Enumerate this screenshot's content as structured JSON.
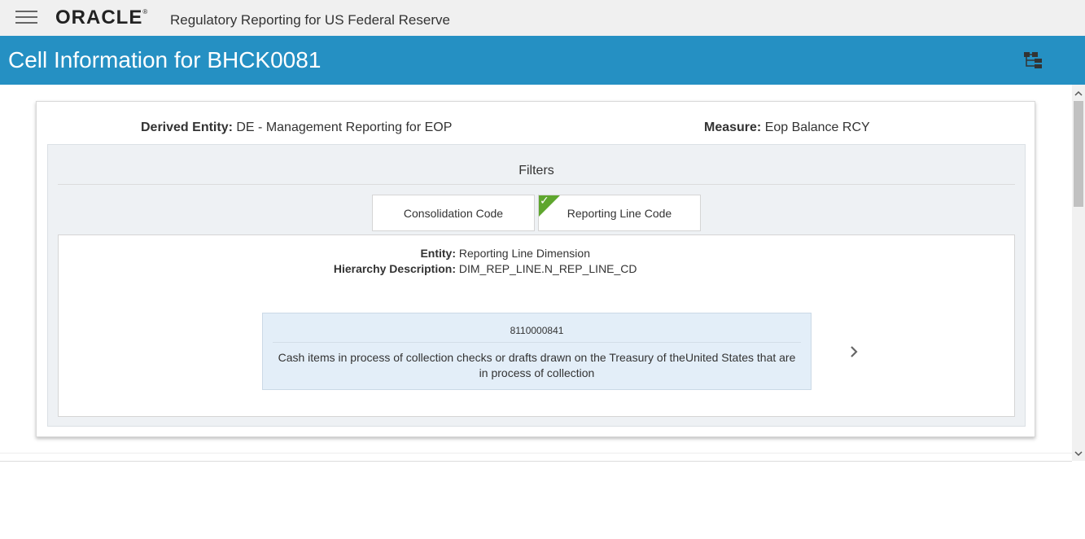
{
  "header": {
    "brand": "ORACLE",
    "app_title": "Regulatory Reporting for US Federal Reserve"
  },
  "title_bar": {
    "title": "Cell Information for BHCK0081"
  },
  "cell_info": {
    "derived_entity_label": "Derived Entity:",
    "derived_entity_value": "DE - Management Reporting for EOP",
    "measure_label": "Measure:",
    "measure_value": "Eop Balance RCY"
  },
  "filters": {
    "title": "Filters",
    "tabs": [
      {
        "label": "Consolidation Code",
        "checked": false
      },
      {
        "label": "Reporting Line Code",
        "checked": true
      }
    ]
  },
  "detail": {
    "entity_label": "Entity:",
    "entity_value": "Reporting Line Dimension",
    "hierarchy_label": "Hierarchy Description:",
    "hierarchy_value": "DIM_REP_LINE.N_REP_LINE_CD"
  },
  "node": {
    "code": "8110000841",
    "description": "Cash items in process of collection checks or drafts drawn on the Treasury of theUnited States that are in process of collection"
  },
  "colors": {
    "title_bar": "#2590c3",
    "top_bar": "#f0f0f0",
    "check": "#5ea62e",
    "node_bg": "#e3eef8"
  }
}
